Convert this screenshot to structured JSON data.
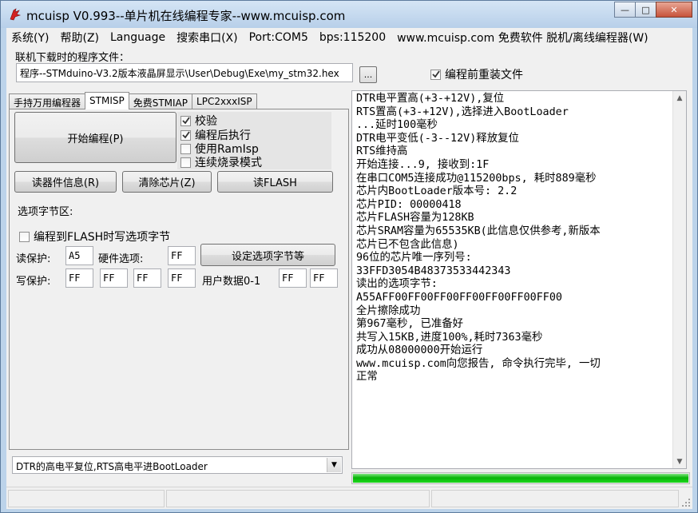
{
  "window": {
    "title": "mcuisp V0.993--单片机在线编程专家--www.mcuisp.com",
    "minimize_glyph": "—",
    "maximize_glyph": "□",
    "close_glyph": "✕",
    "icon": "app-logo-icon"
  },
  "menu": {
    "items": [
      "系统(Y)",
      "帮助(Z)",
      "Language",
      "搜索串口(X)",
      "Port:COM5",
      "bps:115200",
      "www.mcuisp.com 免费软件 脱机/离线编程器(W)"
    ]
  },
  "file": {
    "label": "联机下载时的程序文件：",
    "path": "程序--STMduino-V3.2版本液晶屏显示\\User\\Debug\\Exe\\my_stm32.hex",
    "browse_label": "...",
    "reload_label": "编程前重装文件",
    "reload_checked": true
  },
  "tabs": [
    {
      "label": "手持万用编程器",
      "active": false
    },
    {
      "label": "STMISP",
      "active": true
    },
    {
      "label": "免费STMIAP",
      "active": false
    },
    {
      "label": "LPC2xxxISP",
      "active": false
    }
  ],
  "panel": {
    "start_button": "开始编程(P)",
    "options": [
      {
        "label": "校验",
        "checked": true
      },
      {
        "label": "编程后执行",
        "checked": true
      },
      {
        "label": "使用RamIsp",
        "checked": false
      },
      {
        "label": "连续烧录模式",
        "checked": false
      }
    ],
    "read_info_button": "读器件信息(R)",
    "erase_button": "清除芯片(Z)",
    "read_flash_button": "读FLASH",
    "option_section_label": "选项字节区:",
    "write_opt_to_flash_label": "编程到FLASH时写选项字节",
    "read_protect_label": "读保护:",
    "read_protect_value": "A5",
    "hw_option_label": "硬件选项:",
    "hw_option_value": "FF",
    "set_option_button": "设定选项字节等",
    "write_protect_label": "写保护:",
    "write_protect_values": [
      "FF",
      "FF",
      "FF",
      "FF"
    ],
    "user_data_label": "用户数据0-1",
    "user_data_values": [
      "FF",
      "FF"
    ]
  },
  "combo": {
    "selected": "DTR的高电平复位,RTS高电平进BootLoader"
  },
  "log": {
    "lines": [
      "DTR电平置高(+3-+12V),复位",
      "RTS置高(+3-+12V),选择进入BootLoader",
      "...延时100毫秒",
      "DTR电平变低(-3--12V)释放复位",
      "RTS维持高",
      "开始连接...9, 接收到:1F",
      "在串口COM5连接成功@115200bps, 耗时889毫秒",
      "芯片内BootLoader版本号: 2.2",
      "芯片PID: 00000418",
      "芯片FLASH容量为128KB",
      "芯片SRAM容量为65535KB(此信息仅供参考,新版本",
      "芯片已不包含此信息)",
      "96位的芯片唯一序列号:",
      "33FFD3054B48373533442343",
      "读出的选项字节:",
      "A55AFF00FF00FF00FF00FF00FF00FF00",
      "全片擦除成功",
      "第967毫秒, 已准备好",
      "共写入15KB,进度100%,耗时7363毫秒",
      "成功从08000000开始运行",
      "www.mcuisp.com向您报告, 命令执行完毕, 一切",
      "正常"
    ]
  },
  "progress": {
    "percent": 100,
    "color": "#07b307"
  },
  "colors": {
    "window_frame": "#bcd3ea",
    "client_bg": "#f0f0f0",
    "progress": "#07b307"
  }
}
